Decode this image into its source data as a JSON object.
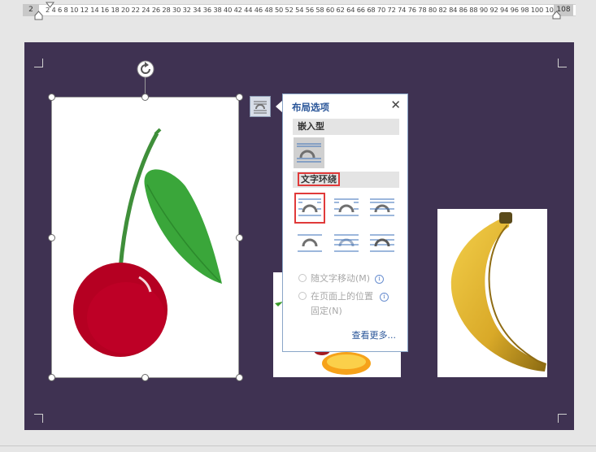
{
  "ruler": {
    "left_margin": "2",
    "right_margin": "108",
    "ticks": "2  4  6  8  10 12 14 16 18 20 22 24 26 28 30 32 34 36 38 40 42 44 46 48 50 52 54 56 58 60 62 64 66 68 70 72 74 76 78 80 82 84 86 88 90 92 94 96 98 100 102 104"
  },
  "images": [
    {
      "name": "cherry",
      "selected": true
    },
    {
      "name": "orange",
      "selected": false
    },
    {
      "name": "banana",
      "selected": false
    }
  ],
  "layout_options_button": {
    "icon": "layout-options-icon"
  },
  "popup": {
    "title": "布局选项",
    "close": "✕",
    "section_inline": "嵌入型",
    "section_wrap": "文字环绕",
    "wrap_options": [
      "square",
      "tight",
      "through",
      "top-and-bottom",
      "behind-text",
      "in-front-of-text"
    ],
    "selected_wrap": "square",
    "radio_move_with_text": "随文字移动(M)",
    "radio_fix_position_line1": "在页面上的位置",
    "radio_fix_position_line2": "固定(N)",
    "see_more": "查看更多..."
  },
  "colors": {
    "page_bg": "#3f3252",
    "highlight_border": "#e03a3a",
    "accent_blue": "#2a5699"
  }
}
